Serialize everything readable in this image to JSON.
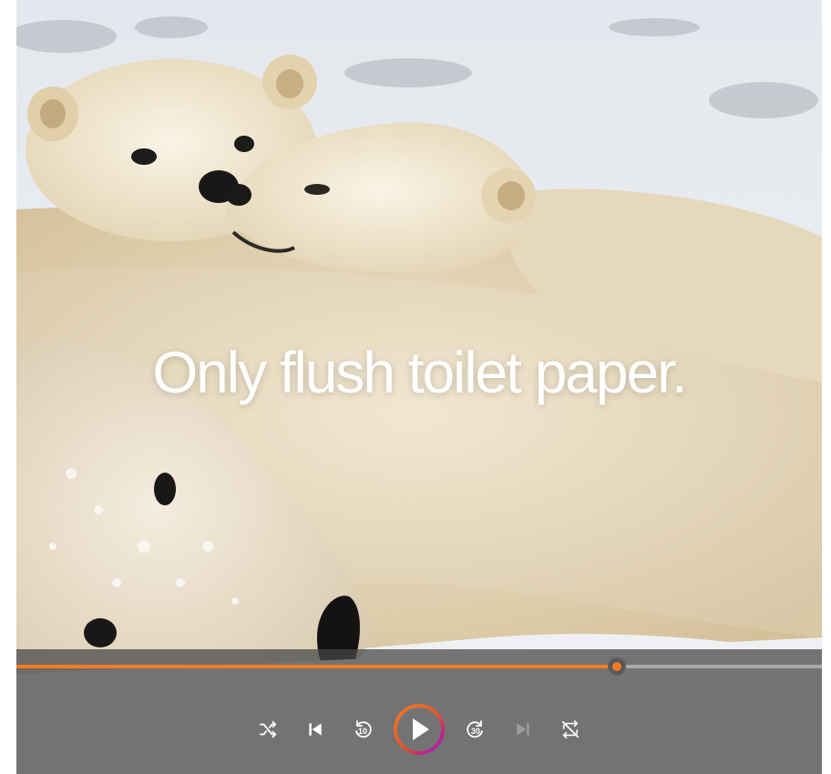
{
  "video": {
    "caption": "Only flush toilet paper.",
    "progress_percent": 74.5
  },
  "controls": {
    "skip_back_seconds": "10",
    "skip_forward_seconds": "30",
    "accent_color": "#f07c27",
    "ring_gradient": [
      "#f07c27",
      "#c02486",
      "#8a2be2"
    ],
    "buttons": [
      {
        "icon": "shuffle-icon"
      },
      {
        "icon": "previous-icon"
      },
      {
        "icon": "skip-back-icon"
      },
      {
        "icon": "play-icon"
      },
      {
        "icon": "skip-forward-icon"
      },
      {
        "icon": "next-icon",
        "disabled": true
      },
      {
        "icon": "repeat-off-icon"
      }
    ]
  }
}
